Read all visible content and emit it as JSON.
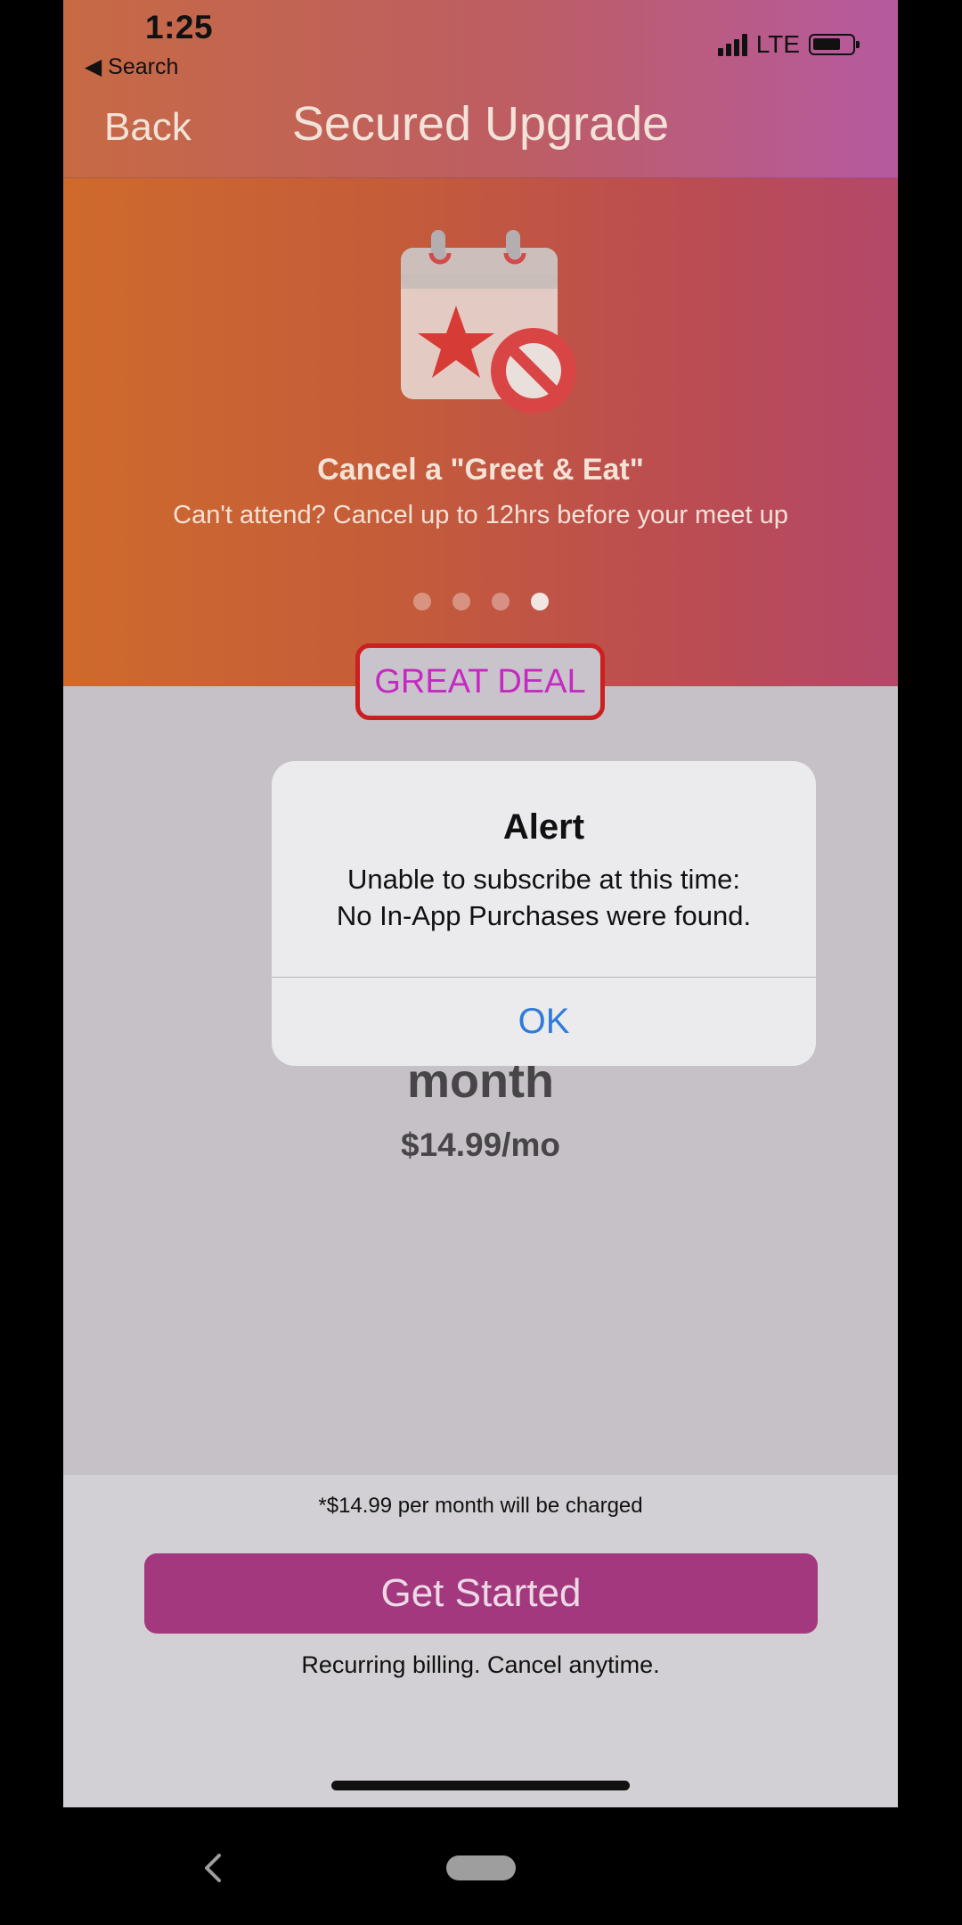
{
  "status_bar": {
    "time": "1:25",
    "back_to_app": "◀ Search",
    "network": "LTE"
  },
  "nav": {
    "back_label": "Back",
    "title": "Secured Upgrade"
  },
  "hero": {
    "icon": "calendar-cancel-icon",
    "title": "Cancel a \"Greet & Eat\"",
    "subtitle": "Can't attend?  Cancel up to 12hrs before your meet up",
    "page_count": 4,
    "active_page": 4
  },
  "badge": {
    "label": "GREAT DEAL"
  },
  "plan": {
    "period": "month",
    "price": "$14.99/mo"
  },
  "footer": {
    "charge_note": "*$14.99 per month will be charged",
    "cta_label": "Get Started",
    "billing_note": "Recurring billing.  Cancel anytime."
  },
  "alert": {
    "title": "Alert",
    "message_line1": "Unable to subscribe at this time:",
    "message_line2": "No In-App Purchases were found.",
    "ok_label": "OK"
  },
  "colors": {
    "accent_magenta": "#a3387e",
    "badge_text": "#c629c2",
    "badge_border": "#cc1f1f",
    "alert_button": "#2f7bd8"
  }
}
